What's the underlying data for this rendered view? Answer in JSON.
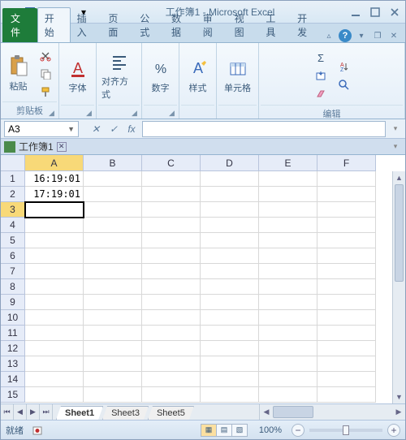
{
  "titlebar": {
    "app_title": "工作簿1 - Microsoft Excel"
  },
  "ribbon": {
    "file_label": "文件",
    "tabs": [
      "开始",
      "插入",
      "页面",
      "公式",
      "数据",
      "审阅",
      "视图",
      "工具",
      "开发"
    ],
    "active_tab_index": 0,
    "groups": {
      "clipboard": {
        "paste": "粘贴",
        "label": "剪贴板"
      },
      "font": {
        "btn": "字体",
        "label": ""
      },
      "align": {
        "btn": "对齐方式",
        "label": ""
      },
      "number": {
        "btn": "数字",
        "label": ""
      },
      "styles": {
        "btn": "样式",
        "label": ""
      },
      "cells": {
        "btn": "单元格",
        "label": ""
      },
      "editing": {
        "label": "编辑"
      }
    }
  },
  "namebox": {
    "value": "A3"
  },
  "formula_bar": {
    "fx": "fx",
    "value": ""
  },
  "workbook_tab": {
    "name": "工作簿1"
  },
  "grid": {
    "columns": [
      "A",
      "B",
      "C",
      "D",
      "E",
      "F"
    ],
    "rows": [
      "1",
      "2",
      "3",
      "4",
      "5",
      "6",
      "7",
      "8",
      "9",
      "10",
      "11",
      "12",
      "13",
      "14",
      "15"
    ],
    "cells": {
      "A1": "16:19:01",
      "A2": "17:19:01"
    },
    "selected": "A3",
    "selected_col": "A",
    "selected_row": "3"
  },
  "sheet_tabs": {
    "tabs": [
      "Sheet1",
      "Sheet3",
      "Sheet5"
    ],
    "active_index": 0
  },
  "statusbar": {
    "mode": "就绪",
    "macro_icon": "macro-record-icon",
    "zoom": "100%"
  }
}
